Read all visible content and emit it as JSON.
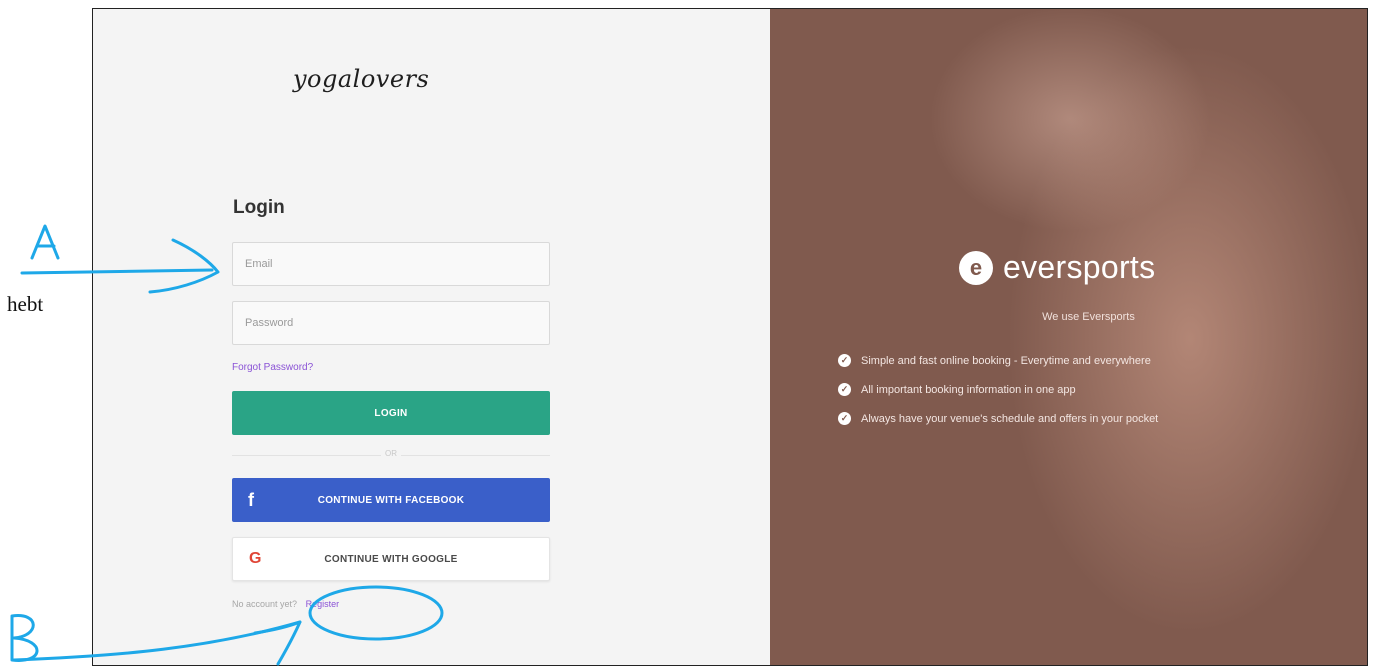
{
  "left": {
    "brand_logo": "yogalovers",
    "login_title": "Login",
    "email": {
      "value": "",
      "placeholder": "Email"
    },
    "password": {
      "value": "",
      "placeholder": "Password"
    },
    "forgot_password": "Forgot Password?",
    "login_button": "LOGIN",
    "divider_text": "OR",
    "facebook_button": "CONTINUE WITH FACEBOOK",
    "facebook_icon": "f",
    "google_button": "CONTINUE WITH GOOGLE",
    "google_icon": "G",
    "no_account_text": "No account yet?",
    "register_link": "Register"
  },
  "right": {
    "logo_mark": "e",
    "brand_name": "eversports",
    "tagline": "We use Eversports",
    "features": [
      "Simple and fast online booking - Everytime and everywhere",
      "All important booking information in one app",
      "Always have your venue's schedule and offers in your pocket"
    ],
    "check_icon": "✓"
  },
  "annotations": {
    "label_a": "A",
    "label_b": "B",
    "side_note": "hebt",
    "ink_color": "#1ea8e8"
  },
  "colors": {
    "primary_green": "#2aa486",
    "facebook_blue": "#3a5fc9",
    "link_purple": "#8b53d6",
    "right_panel": "#805a4e"
  }
}
